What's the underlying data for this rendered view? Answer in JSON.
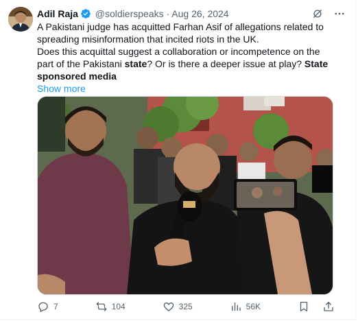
{
  "author": {
    "name": "Adil Raja",
    "handle": "@soldierspeaks",
    "separator": "·",
    "date": "Aug 26, 2024"
  },
  "tweet": {
    "line1": "A Pakistani judge has acquitted Farhan Asif of allegations related to spreading misinformation that incited riots in the UK.",
    "line2_a": "Does this acquittal suggest a collaboration or incompetence on the part of the Pakistani ",
    "line2_bold1": "state",
    "line2_b": "? Or is there a deeper issue at play? ",
    "line2_bold2": "State sponsored media",
    "show_more": "Show more"
  },
  "actions": {
    "replies": "7",
    "reposts": "104",
    "likes": "325",
    "views": "56K"
  },
  "colors": {
    "accent": "#1d9bf0",
    "muted": "#536471",
    "text": "#0f1419"
  },
  "icons": [
    "verified-icon",
    "grok-icon",
    "more-icon",
    "reply-icon",
    "repost-icon",
    "like-icon",
    "views-icon",
    "bookmark-icon",
    "share-icon"
  ]
}
